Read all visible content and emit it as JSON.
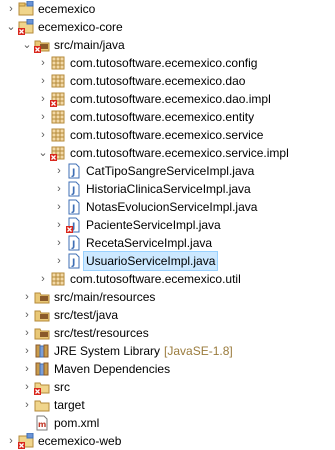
{
  "tree": [
    {
      "label": "ecemexico",
      "kind": "project",
      "arrow": "right",
      "error": false
    },
    {
      "label": "ecemexico-core",
      "kind": "project",
      "arrow": "down",
      "error": true
    },
    {
      "label": "src/main/java",
      "kind": "srcfolder",
      "arrow": "down",
      "error": true
    },
    {
      "label": "com.tutosoftware.ecemexico.config",
      "kind": "package",
      "arrow": "right",
      "error": false
    },
    {
      "label": "com.tutosoftware.ecemexico.dao",
      "kind": "package",
      "arrow": "right",
      "error": false
    },
    {
      "label": "com.tutosoftware.ecemexico.dao.impl",
      "kind": "package",
      "arrow": "right",
      "error": true
    },
    {
      "label": "com.tutosoftware.ecemexico.entity",
      "kind": "package",
      "arrow": "right",
      "error": false
    },
    {
      "label": "com.tutosoftware.ecemexico.service",
      "kind": "package",
      "arrow": "right",
      "error": false
    },
    {
      "label": "com.tutosoftware.ecemexico.service.impl",
      "kind": "package",
      "arrow": "down",
      "error": true
    },
    {
      "label": "CatTipoSangreServiceImpl.java",
      "kind": "javafile",
      "arrow": "right",
      "error": false
    },
    {
      "label": "HistoriaClinicaServiceImpl.java",
      "kind": "javafile",
      "arrow": "right",
      "error": false
    },
    {
      "label": "NotasEvolucionServiceImpl.java",
      "kind": "javafile",
      "arrow": "right",
      "error": false
    },
    {
      "label": "PacienteServiceImpl.java",
      "kind": "javafile",
      "arrow": "right",
      "error": true
    },
    {
      "label": "RecetaServiceImpl.java",
      "kind": "javafile",
      "arrow": "right",
      "error": false
    },
    {
      "label": "UsuarioServiceImpl.java",
      "kind": "javafile",
      "arrow": "right",
      "error": false,
      "selected": true
    },
    {
      "label": "com.tutosoftware.ecemexico.util",
      "kind": "package",
      "arrow": "right",
      "error": false
    },
    {
      "label": "src/main/resources",
      "kind": "srcfolder",
      "arrow": "right",
      "error": false
    },
    {
      "label": "src/test/java",
      "kind": "srcfolder",
      "arrow": "right",
      "error": false
    },
    {
      "label": "src/test/resources",
      "kind": "srcfolder",
      "arrow": "right",
      "error": false
    },
    {
      "label": "JRE System Library",
      "decoration": "[JavaSE-1.8]",
      "kind": "library",
      "arrow": "right",
      "error": false
    },
    {
      "label": "Maven Dependencies",
      "kind": "library",
      "arrow": "right",
      "error": false
    },
    {
      "label": "src",
      "kind": "folder",
      "arrow": "right",
      "error": true
    },
    {
      "label": "target",
      "kind": "folder",
      "arrow": "right",
      "error": false
    },
    {
      "label": "pom.xml",
      "kind": "xmlfile",
      "arrow": "none",
      "error": false
    },
    {
      "label": "ecemexico-web",
      "kind": "project",
      "arrow": "right",
      "error": true
    }
  ],
  "colors": {
    "selection_bg": "#cce8ff",
    "package_brown": "#b58a3a",
    "error_red": "#d9261c",
    "java_blue": "#3f6fb5",
    "decoration_text": "#9a7b3c"
  }
}
